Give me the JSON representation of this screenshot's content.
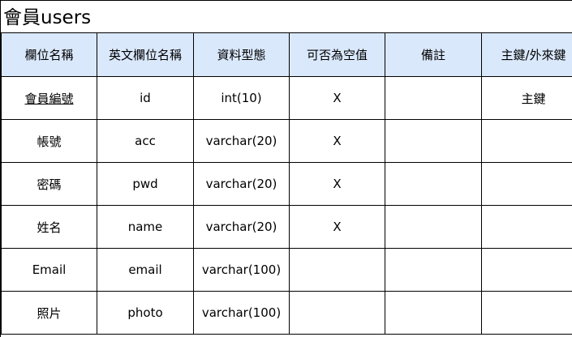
{
  "title": "會員users",
  "headers": [
    "欄位名稱",
    "英文欄位名稱",
    "資料型態",
    "可否為空值",
    "備註",
    "主鍵/外來鍵"
  ],
  "rows": [
    {
      "name": "會員編號",
      "english": "id",
      "type": "int(10)",
      "nullable": "X",
      "note": "",
      "key": "主鍵"
    },
    {
      "name": "帳號",
      "english": "acc",
      "type": "varchar(20)",
      "nullable": "X",
      "note": "",
      "key": ""
    },
    {
      "name": "密碼",
      "english": "pwd",
      "type": "varchar(20)",
      "nullable": "X",
      "note": "",
      "key": ""
    },
    {
      "name": "姓名",
      "english": "name",
      "type": "varchar(20)",
      "nullable": "X",
      "note": "",
      "key": ""
    },
    {
      "name": "Email",
      "english": "email",
      "type": "varchar(100)",
      "nullable": "",
      "note": "",
      "key": ""
    },
    {
      "name": "照片",
      "english": "photo",
      "type": "varchar(100)",
      "nullable": "",
      "note": "",
      "key": ""
    }
  ]
}
